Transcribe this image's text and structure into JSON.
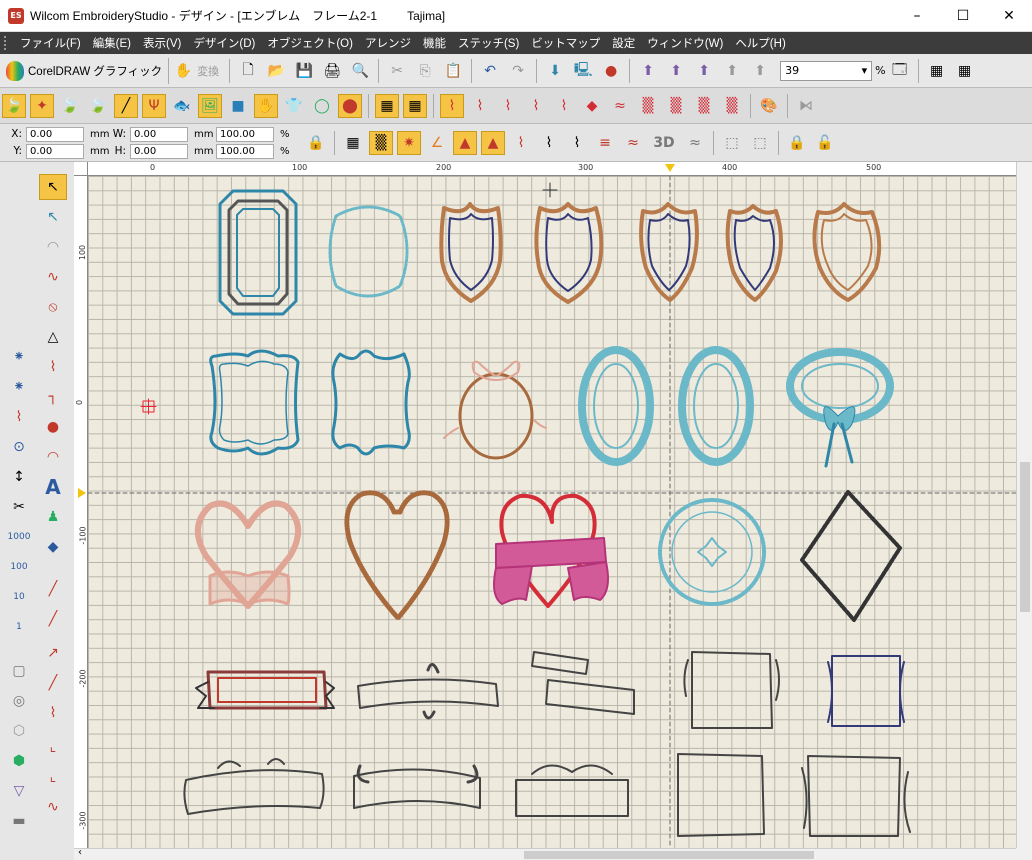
{
  "window": {
    "title_main": "Wilcom EmbroideryStudio - デザイン - [エンブレム　フレーム2-1",
    "title_machine": "Tajima]",
    "app_icon": "ES"
  },
  "menu": [
    "ファイル(F)",
    "編集(E)",
    "表示(V)",
    "デザイン(D)",
    "オブジェクト(O)",
    "アレンジ",
    "機能",
    "ステッチ(S)",
    "ビットマップ",
    "設定",
    "ウィンドウ(W)",
    "ヘルプ(H)"
  ],
  "toolbar": {
    "coreldraw_label": "CorelDRAW グラフィック",
    "convert_label": "変換",
    "zoom_value": "39",
    "zoom_unit": "%",
    "three_d_label": "3D"
  },
  "properties": {
    "x_label": "X:",
    "x_value": "0.00",
    "x_unit": "mm",
    "y_label": "Y:",
    "y_value": "0.00",
    "y_unit": "mm",
    "w_label": "W:",
    "w_value": "0.00",
    "w_unit": "mm",
    "h_label": "H:",
    "h_value": "0.00",
    "h_unit": "mm",
    "w_pct": "100.00",
    "h_pct": "100.00",
    "pct_unit": "%"
  },
  "ruler": {
    "top": [
      "0",
      "100",
      "200",
      "300",
      "400",
      "500"
    ],
    "left": [
      "100",
      "0",
      "-100",
      "-200",
      "-300"
    ]
  },
  "left_tool_numbers": [
    "1000",
    "100",
    "10",
    "1"
  ],
  "colors": {
    "canvas_bg": "#eeeade",
    "teal": "#2e86a8",
    "light_teal": "#6ab8c8",
    "brown": "#a8693d",
    "navy": "#343a78",
    "pink": "#d35a98",
    "red": "#d42d38",
    "salmon": "#e0a595",
    "dark": "#333333"
  }
}
